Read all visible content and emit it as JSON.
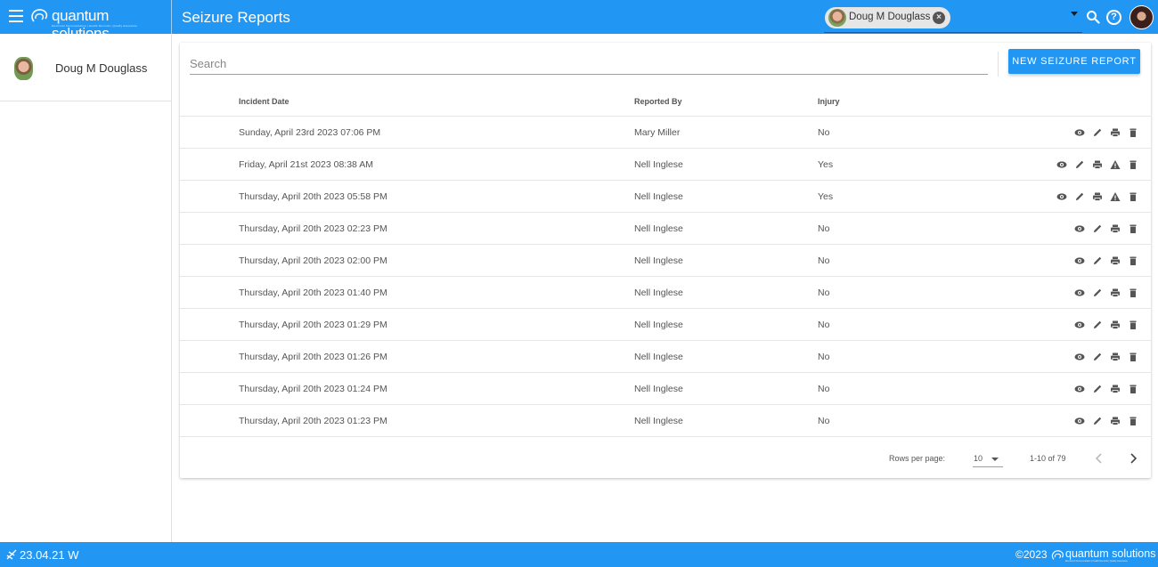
{
  "app": {
    "brand": "quantum solutions",
    "brand_tagline": "Electronic Documentation  |  Health Records  |  Quality Assurance",
    "page_title": "Seizure Reports"
  },
  "header": {
    "selected_person_chip": "Doug M Douglass",
    "icons": [
      "menu-icon",
      "chip-avatar",
      "close-circle-icon",
      "dropdown-arrow-icon",
      "search-icon",
      "help-icon",
      "user-avatar"
    ]
  },
  "sidebar": {
    "person_name": "Doug M Douglass"
  },
  "toolbar": {
    "search_placeholder": "Search",
    "new_button_label": "NEW SEIZURE REPORT"
  },
  "table": {
    "headers": {
      "incident_date": "Incident Date",
      "reported_by": "Reported By",
      "injury": "Injury"
    },
    "rows": [
      {
        "date": "Sunday, April 23rd 2023 07:06 PM",
        "reported_by": "Mary Miller",
        "injury": "No",
        "actions": [
          "view",
          "edit",
          "print",
          "delete"
        ]
      },
      {
        "date": "Friday, April 21st 2023 08:38 AM",
        "reported_by": "Nell Inglese",
        "injury": "Yes",
        "actions": [
          "view",
          "edit",
          "print",
          "warning",
          "delete"
        ]
      },
      {
        "date": "Thursday, April 20th 2023 05:58 PM",
        "reported_by": "Nell Inglese",
        "injury": "Yes",
        "actions": [
          "view",
          "edit",
          "print",
          "warning",
          "delete"
        ]
      },
      {
        "date": "Thursday, April 20th 2023 02:23 PM",
        "reported_by": "Nell Inglese",
        "injury": "No",
        "actions": [
          "view",
          "edit",
          "print",
          "delete"
        ]
      },
      {
        "date": "Thursday, April 20th 2023 02:00 PM",
        "reported_by": "Nell Inglese",
        "injury": "No",
        "actions": [
          "view",
          "edit",
          "print",
          "delete"
        ]
      },
      {
        "date": "Thursday, April 20th 2023 01:40 PM",
        "reported_by": "Nell Inglese",
        "injury": "No",
        "actions": [
          "view",
          "edit",
          "print",
          "delete"
        ]
      },
      {
        "date": "Thursday, April 20th 2023 01:29 PM",
        "reported_by": "Nell Inglese",
        "injury": "No",
        "actions": [
          "view",
          "edit",
          "print",
          "delete"
        ]
      },
      {
        "date": "Thursday, April 20th 2023 01:26 PM",
        "reported_by": "Nell Inglese",
        "injury": "No",
        "actions": [
          "view",
          "edit",
          "print",
          "delete"
        ]
      },
      {
        "date": "Thursday, April 20th 2023 01:24 PM",
        "reported_by": "Nell Inglese",
        "injury": "No",
        "actions": [
          "view",
          "edit",
          "print",
          "delete"
        ]
      },
      {
        "date": "Thursday, April 20th 2023 01:23 PM",
        "reported_by": "Nell Inglese",
        "injury": "No",
        "actions": [
          "view",
          "edit",
          "print",
          "delete"
        ]
      }
    ]
  },
  "pagination": {
    "rows_per_page_label": "Rows per page:",
    "rows_per_page_value": "10",
    "range_text": "1-10 of 79"
  },
  "footer": {
    "version": "23.04.21 W",
    "copyright": "©2023",
    "brand": "quantum solutions",
    "brand_tagline": "Electronic Documentation  |  Health Records  |  Quality Assurance"
  },
  "colors": {
    "primary": "#2196f3",
    "icon_gray": "#555555"
  }
}
